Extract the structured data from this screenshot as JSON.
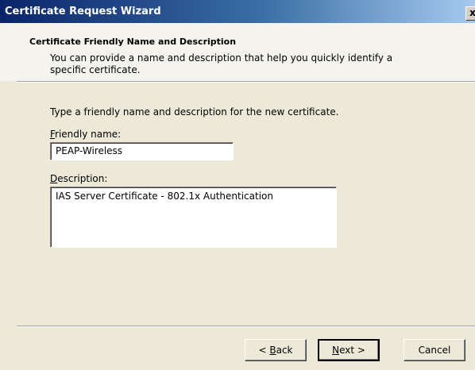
{
  "window": {
    "title": "Certificate Request Wizard",
    "close_symbol": "x"
  },
  "header": {
    "title": "Certificate Friendly Name and Description",
    "description": "You can provide a name and description that help you quickly identify a specific certificate."
  },
  "body": {
    "intro": "Type a friendly name and description for the new certificate.",
    "friendly_name": {
      "label_accel": "F",
      "label_rest": "riendly name:",
      "value": "PEAP-Wireless"
    },
    "description": {
      "label_accel": "D",
      "label_rest": "escription:",
      "value": "IAS Server Certificate - 802.1x Authentication"
    }
  },
  "footer": {
    "back_prefix": "< ",
    "back_accel": "B",
    "back_rest": "ack",
    "next_accel": "N",
    "next_rest": "ext >",
    "cancel_label": "Cancel"
  }
}
